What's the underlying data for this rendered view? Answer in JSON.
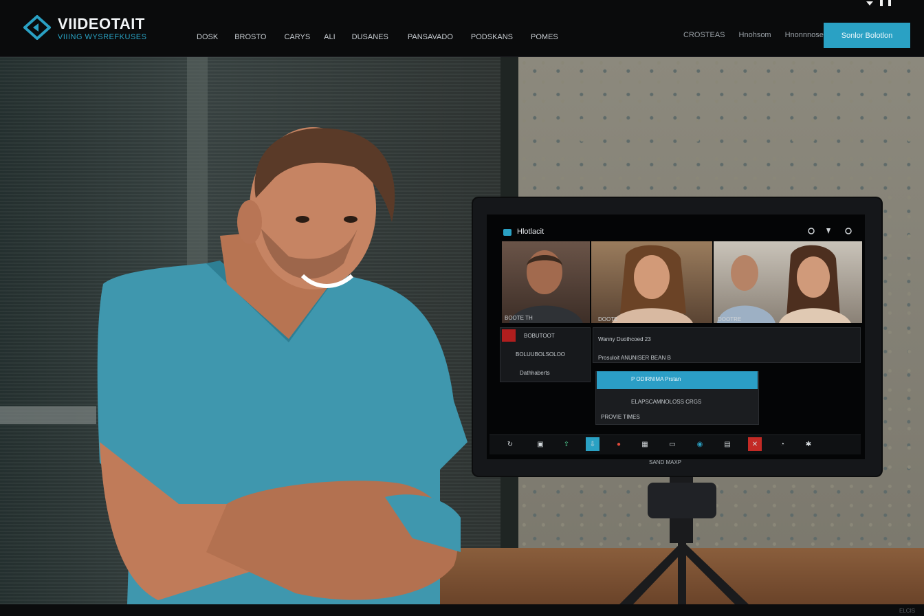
{
  "header": {
    "brand": "VIIDEOTAIT",
    "tagline": "VIIING WYSREFKUSES",
    "nav": [
      "DOSK",
      "BROSTO",
      "CARYS",
      "ALI",
      "DUSANES",
      "PANSAVADO",
      "PODSKANS",
      "POMES"
    ],
    "nav_right": [
      "CROSTEAS",
      "Hnohsom",
      "Hnonnnose"
    ],
    "cta_label": "Sonlor Bolotlon",
    "accent": "#2aa1c4"
  },
  "monitor": {
    "app_title": "Hlotlacit",
    "tiles": [
      {
        "label": "BOOTE TH"
      },
      {
        "label": "DOOTE"
      },
      {
        "label": ""
      },
      {
        "label": "DOOTRE"
      }
    ],
    "left_rows": [
      "BOBUTOOT",
      "BOLUUBOLSOLOO",
      "Dathhaberts"
    ],
    "right_rows": [
      "Wanny  Duothcoed 23",
      "Prosuloit ANUNISER BEAN B"
    ],
    "callbar": "P ODIRNIMA  Prstan",
    "call_row": "ELAPSCAMNOLOSS CRGS",
    "call_row2": "PROVIE TIMES",
    "toolbar_icons": [
      "refresh-icon",
      "camera-icon",
      "share-icon",
      "download-icon",
      "record-icon",
      "grid-icon",
      "chat-icon",
      "globe-icon",
      "screen-icon",
      "end-call-icon",
      "timer-icon",
      "settings-icon"
    ],
    "brand_label": "SAND MAXP"
  },
  "footer": {
    "corner": "ELCIS"
  }
}
